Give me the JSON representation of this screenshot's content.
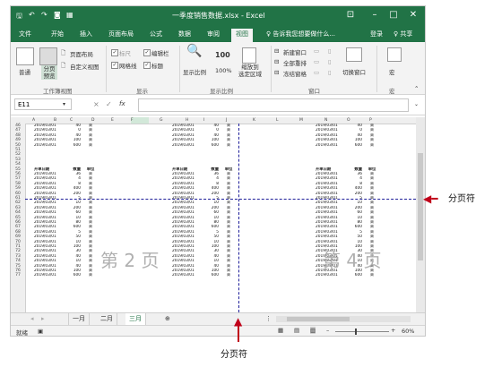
{
  "window": {
    "title": "一季度销售数据.xlsx - Excel",
    "icons": [
      "save-icon",
      "undo-icon",
      "redo-icon",
      "camera-icon",
      "table-icon"
    ]
  },
  "ribbon_tabs": [
    "文件",
    "开始",
    "插入",
    "页面布局",
    "公式",
    "数据",
    "审阅",
    "视图"
  ],
  "active_tab": "视图",
  "tell_me": "♀ 告诉我您想要做什么...",
  "user": "登录",
  "share": "♀ 共享",
  "ribbon": {
    "workbook_views": {
      "normal": "普通",
      "pagebreak": "分页\n预览",
      "page_layout": "页面布局",
      "custom_views": "自定义视图",
      "group_label": "工作簿视图"
    },
    "show": {
      "ruler": "标尺",
      "formula_bar": "编辑栏",
      "gridlines": "网格线",
      "headings": "标题",
      "group_label": "显示"
    },
    "zoom": {
      "zoom": "显示比例",
      "hundred": "100%",
      "zoom_to_selection": "缩放到\n选定区域",
      "group_label": "显示比例"
    },
    "window": {
      "new_window": "新建窗口",
      "arrange_all": "全部重排",
      "freeze_panes": "冻结窗格",
      "switch_windows": "切换窗口",
      "group_label": "窗口"
    },
    "macros": {
      "macros": "宏",
      "group_label": "宏"
    }
  },
  "formula_bar": {
    "name_box": "E11",
    "cancel": "×",
    "enter": "✓",
    "fx": "fx"
  },
  "columns": [
    "A",
    "B",
    "C",
    "D",
    "E",
    "F",
    "G",
    "H",
    "I",
    "J",
    "K",
    "L",
    "M",
    "N",
    "O",
    "P"
  ],
  "rows_top": [
    {
      "n": "46",
      "date": "2019/03/01",
      "qty": "40",
      "unit": "束"
    },
    {
      "n": "47",
      "date": "2019/03/01",
      "qty": "0",
      "unit": "束"
    },
    {
      "n": "48",
      "date": "2019/03/01",
      "qty": "40",
      "unit": "束"
    },
    {
      "n": "49",
      "date": "2019/03/01",
      "qty": "100",
      "unit": "束"
    },
    {
      "n": "50",
      "date": "2019/03/01",
      "qty": "600",
      "unit": "束"
    }
  ],
  "header_row": {
    "n": "55",
    "date": "开单日期",
    "qty": "数量",
    "unit": "单位"
  },
  "rows_bottom": [
    {
      "n": "56",
      "date": "2019/03/01",
      "qty": "36",
      "unit": "束"
    },
    {
      "n": "57",
      "date": "2019/03/01",
      "qty": "4",
      "unit": "束"
    },
    {
      "n": "58",
      "date": "2019/03/01",
      "qty": "8",
      "unit": "束"
    },
    {
      "n": "59",
      "date": "2019/03/01",
      "qty": "400",
      "unit": "束"
    },
    {
      "n": "60",
      "date": "2019/03/01",
      "qty": "200",
      "unit": "束"
    },
    {
      "n": "61",
      "date": "2019/03/01",
      "qty": "5",
      "unit": "束"
    },
    {
      "n": "62",
      "date": "2019/03/01",
      "qty": "10",
      "unit": "束"
    },
    {
      "n": "63",
      "date": "2019/03/01",
      "qty": "200",
      "unit": "束"
    },
    {
      "n": "64",
      "date": "2019/03/01",
      "qty": "60",
      "unit": "束"
    },
    {
      "n": "65",
      "date": "2019/03/01",
      "qty": "10",
      "unit": "束"
    },
    {
      "n": "66",
      "date": "2019/03/01",
      "qty": "80",
      "unit": "束"
    },
    {
      "n": "67",
      "date": "2019/03/01",
      "qty": "600",
      "unit": "束"
    },
    {
      "n": "68",
      "date": "2019/03/01",
      "qty": "5",
      "unit": "束"
    },
    {
      "n": "69",
      "date": "2019/03/01",
      "qty": "50",
      "unit": "束"
    },
    {
      "n": "70",
      "date": "2019/03/01",
      "qty": "10",
      "unit": "束"
    },
    {
      "n": "71",
      "date": "2019/03/01",
      "qty": "100",
      "unit": "束"
    },
    {
      "n": "72",
      "date": "2019/03/01",
      "qty": "30",
      "unit": "束"
    },
    {
      "n": "73",
      "date": "2019/03/01",
      "qty": "40",
      "unit": "束"
    },
    {
      "n": "74",
      "date": "2019/03/01",
      "qty": "10",
      "unit": "束"
    },
    {
      "n": "75",
      "date": "2019/03/01",
      "qty": "40",
      "unit": "束"
    },
    {
      "n": "76",
      "date": "2019/03/01",
      "qty": "100",
      "unit": "束"
    },
    {
      "n": "77",
      "date": "2019/03/01",
      "qty": "600",
      "unit": "束"
    }
  ],
  "blank_rows": [
    "51",
    "52",
    "53",
    "54"
  ],
  "watermarks": {
    "page2": "第 2 页",
    "page4": "第 4 页"
  },
  "sheet_tabs": [
    "一月",
    "二月",
    "三月"
  ],
  "active_sheet": "三月",
  "status": {
    "ready": "就绪",
    "zoom": "60%"
  },
  "annotations": {
    "right": "分页符",
    "bottom": "分页符"
  }
}
